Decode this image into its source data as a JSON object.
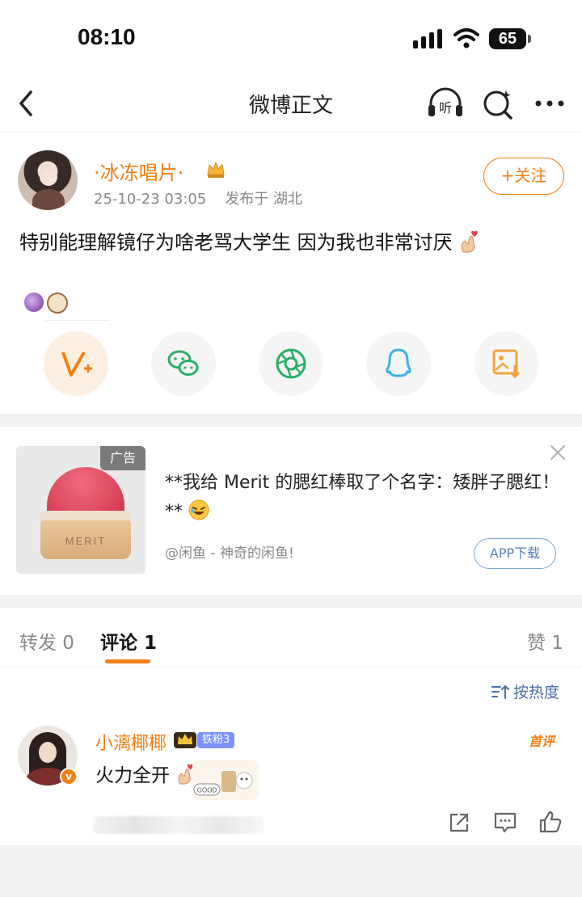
{
  "status_bar": {
    "time": "08:10",
    "battery": "65"
  },
  "nav": {
    "title": "微博正文",
    "listen_label": "听"
  },
  "post": {
    "username": "·冰冻唱片·",
    "timestamp": "25-10-23 03:05",
    "location": "发布于 湖北",
    "follow_label": "+关注",
    "text": "特别能理解镜仔为啥老骂大学生 因为我也非常讨厌"
  },
  "share_icons": [
    "weibo-repost-icon",
    "wechat-icon",
    "moments-icon",
    "qq-icon",
    "save-image-icon"
  ],
  "ad": {
    "tag": "广告",
    "brand_mark": "MERIT",
    "title": "**我给 Merit 的腮红棒取了个名字：矮胖子腮红！**",
    "source": "@闲鱼 - 神奇的闲鱼!",
    "cta": "APP下载"
  },
  "tabs": {
    "repost": "转发 0",
    "comment": "评论 1",
    "like": "赞 1"
  },
  "sort_label": "按热度",
  "comment": {
    "username": "小漓椰椰",
    "fan_badge": "铁粉3",
    "first_badge": "首评",
    "text": "火力全开",
    "verified_mark": "v",
    "sticker_label": "GOOD"
  },
  "colors": {
    "accent": "#f28014",
    "link": "#4a6ea9",
    "band": "#f2f2f2"
  }
}
